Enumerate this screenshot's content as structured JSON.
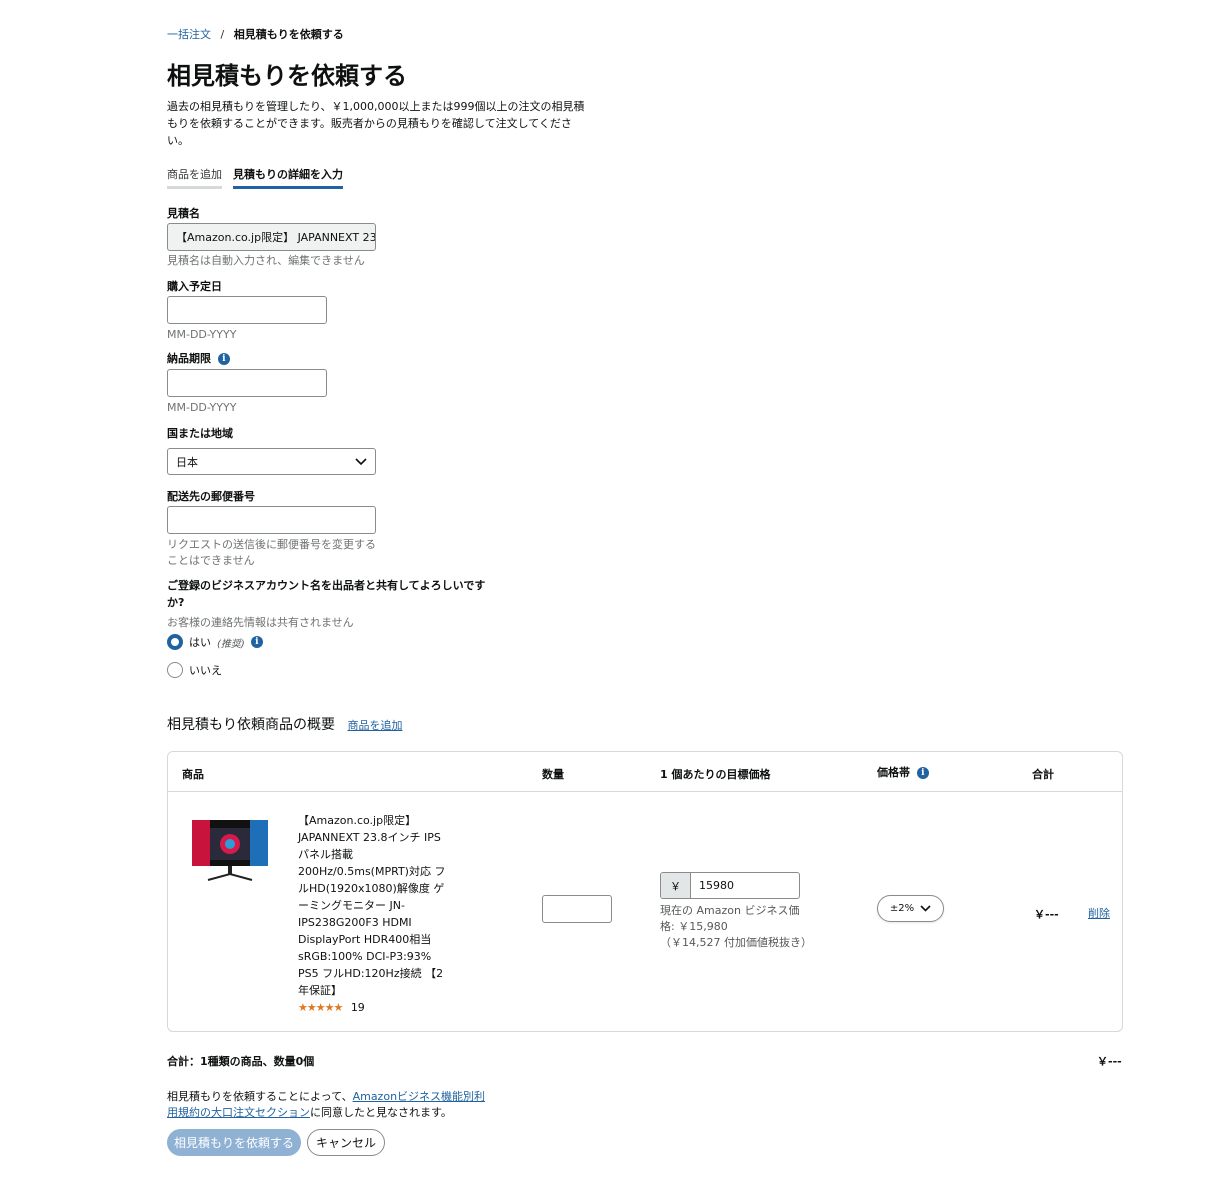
{
  "breadcrumb": {
    "parent": "一括注文",
    "separator": "/",
    "current": "相見積もりを依頼する"
  },
  "page_title": "相見積もりを依頼する",
  "intro": "過去の相見積もりを管理したり、￥1,000,000以上または999個以上の注文の相見積もりを依頼することができます。販売者からの見積もりを確認して注文してください。",
  "tabs": [
    {
      "label": "商品を追加",
      "active": false
    },
    {
      "label": "見積もりの詳細を入力",
      "active": true
    }
  ],
  "form": {
    "quote_name_label": "見積名",
    "quote_name_value": "【Amazon.co.jp限定】 JAPANNEXT 23",
    "quote_name_hint": "見積名は自動入力され、編集できません",
    "purchase_date_label": "購入予定日",
    "purchase_date_hint": "MM-DD-YYYY",
    "delivery_deadline_label": "納品期限",
    "delivery_deadline_hint": "MM-DD-YYYY",
    "country_label": "国または地域",
    "country_value": "日本",
    "postal_label": "配送先の郵便番号",
    "postal_hint": "リクエストの送信後に郵便番号を変更することはできません",
    "share_question": "ご登録のビジネスアカウント名を出品者と共有してよろしいですか?",
    "share_hint": "お客様の連絡先情報は共有されません",
    "share_yes": "はい",
    "share_yes_note": "(推奨)",
    "share_no": "いいえ",
    "share_selected": "yes"
  },
  "summary": {
    "title": "相見積もり依頼商品の概要",
    "add_link": "商品を追加",
    "columns": [
      "商品",
      "数量",
      "1 個あたりの目標価格",
      "価格帯",
      "合計"
    ],
    "item": {
      "name": "【Amazon.co.jp限定】JAPANNEXT 23.8インチ IPSパネル搭載 200Hz/0.5ms(MPRT)対応 フルHD(1920x1080)解像度 ゲーミングモニター JN-IPS238G200F3 HDMI DisplayPort HDR400相当 sRGB:100% DCI-P3:93% PS5 フルHD:120Hz接続 【2年保証】",
      "rating": 4.5,
      "rating_stars": "★★★★★",
      "review_count": "19",
      "currency": "￥",
      "target_price": "15980",
      "business_price_label": "現在の Amazon ビジネス価格: ￥15,980",
      "price_ex_tax": "（￥14,527 付加価値税抜き）",
      "price_band": "±2%",
      "total": "￥---",
      "delete_label": "削除"
    }
  },
  "totals": {
    "label": "合計：1種類の商品、数量0個",
    "value": "￥---"
  },
  "agreement": {
    "prefix": "相見積もりを依頼することによって、",
    "link": "Amazonビジネス機能別利用規約の大口注文セクション",
    "suffix": "に同意したと見なされます。"
  },
  "buttons": {
    "submit": "相見積もりを依頼する",
    "cancel": "キャンセル"
  },
  "colors": {
    "link": "#2162a1",
    "primary_disabled": "#8fb1d4",
    "star": "#de7921"
  }
}
